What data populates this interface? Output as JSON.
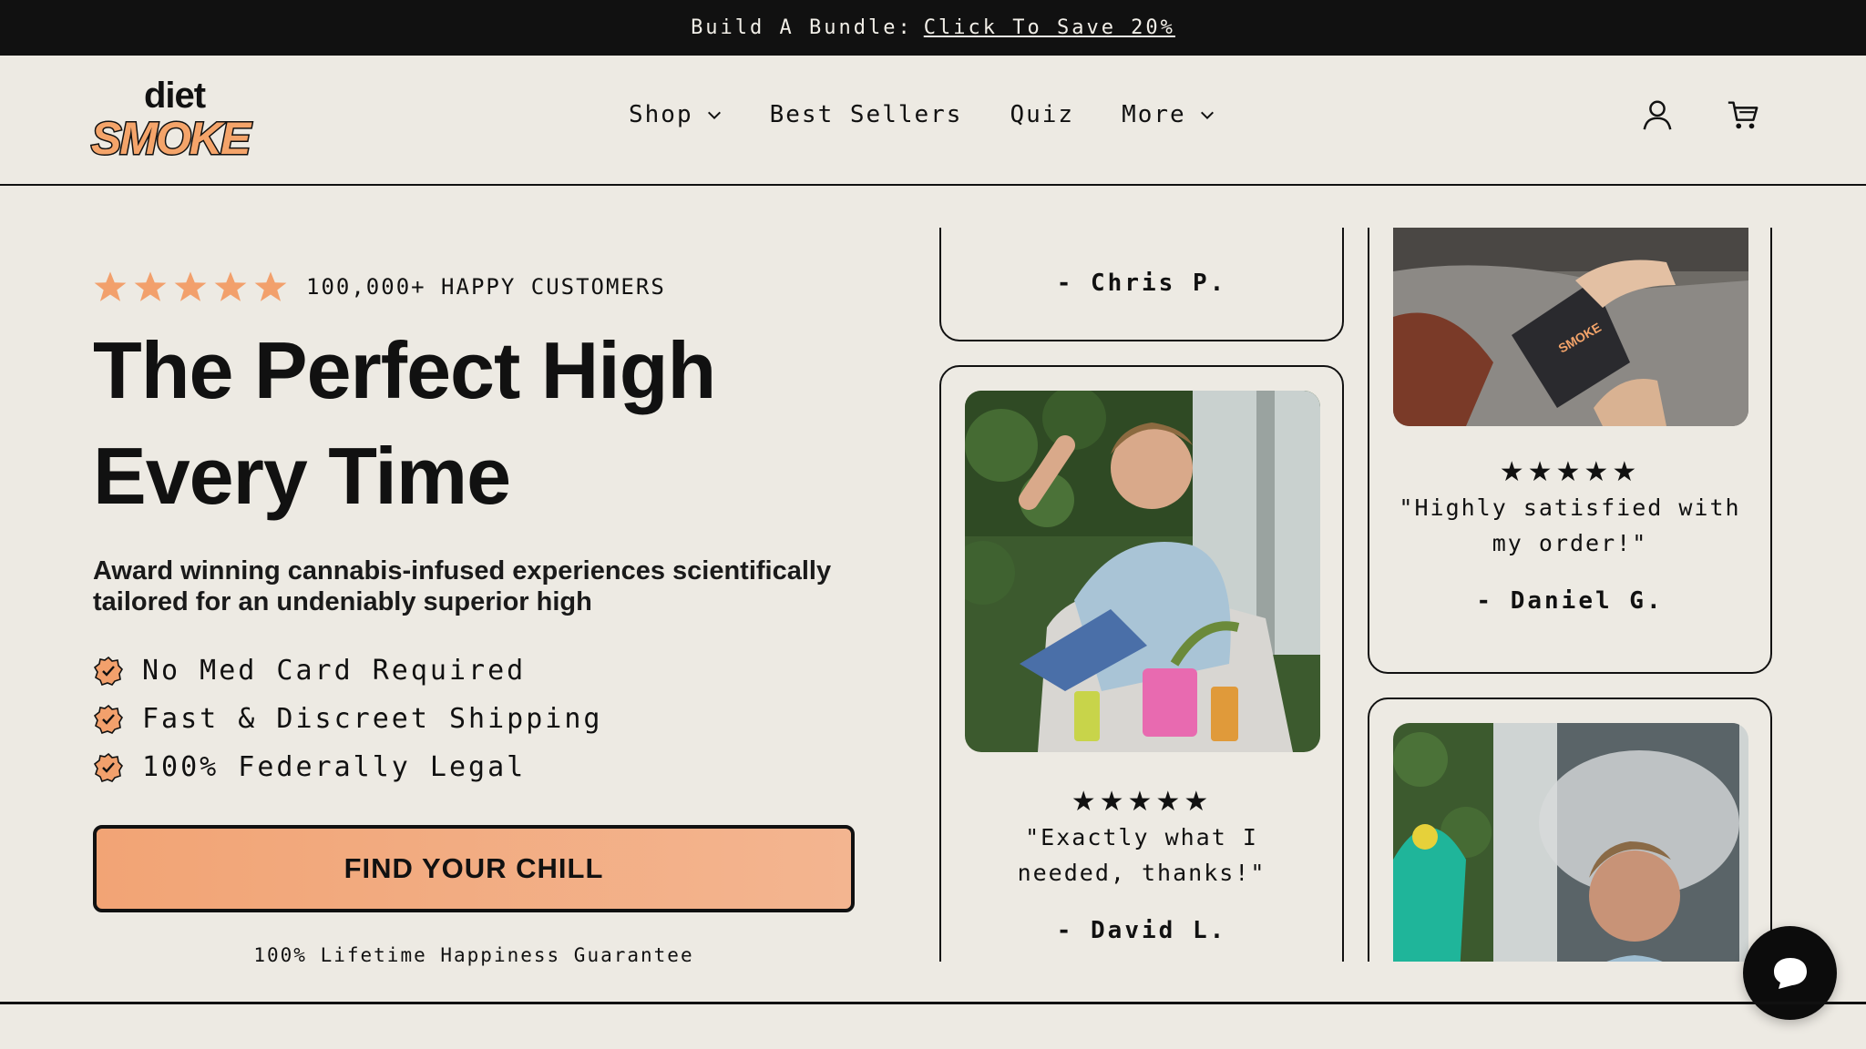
{
  "announcement": {
    "prefix": "Build A Bundle:",
    "link": "Click To Save 20%"
  },
  "brand": {
    "top": "diet",
    "bottom": "SMOKE",
    "accent_color": "#f4a46a"
  },
  "nav": {
    "items": [
      {
        "label": "Shop",
        "has_dropdown": true
      },
      {
        "label": "Best Sellers",
        "has_dropdown": false
      },
      {
        "label": "Quiz",
        "has_dropdown": false
      },
      {
        "label": "More",
        "has_dropdown": true
      }
    ],
    "icons": [
      "account-icon",
      "cart-icon"
    ]
  },
  "hero": {
    "rating_text": "100,000+ HAPPY CUSTOMERS",
    "star_count": 5,
    "star_color": "#f2a06c",
    "headline_line1": "The Perfect High",
    "headline_line2": "Every Time",
    "subhead": "Award winning cannabis-infused experiences scientifically tailored for an undeniably superior high",
    "features": [
      "No Med Card Required",
      "Fast & Discreet Shipping",
      "100% Federally Legal"
    ],
    "cta_label": "FIND YOUR CHILL",
    "guarantee": "100% Lifetime Happiness Guarantee"
  },
  "reviews": {
    "chris": {
      "author": "- Chris P."
    },
    "david": {
      "stars": "★★★★★",
      "quote": "\"Exactly what I needed, thanks!\"",
      "author": "- David L."
    },
    "daniel": {
      "stars": "★★★★★",
      "quote": "\"Highly satisfied with my order!\"",
      "author": "- Daniel G."
    }
  },
  "chat": {
    "icon": "chat-bubble-icon"
  }
}
